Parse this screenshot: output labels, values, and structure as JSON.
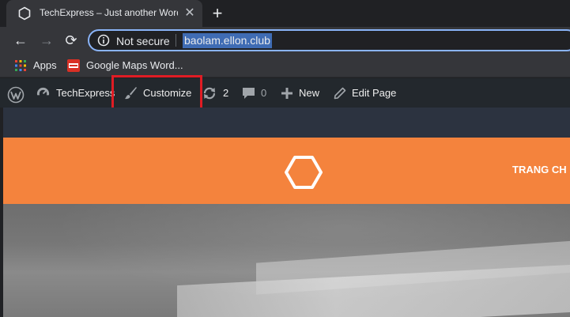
{
  "browser": {
    "tab": {
      "title": "TechExpress – Just another Word",
      "close_glyph": "✕",
      "favicon_icon": "hexagon-icon"
    },
    "new_tab_glyph": "+",
    "nav": {
      "back_glyph": "←",
      "forward_glyph": "→",
      "reload_glyph": "⟳"
    },
    "omnibox": {
      "security_label": "Not secure",
      "url": "baolam.ellon.club"
    },
    "bookmarks": [
      {
        "label": "Apps",
        "icon": "apps-grid-icon"
      },
      {
        "label": "Google Maps Word...",
        "icon": "maps-favicon-icon"
      }
    ]
  },
  "adminbar": {
    "site_name": "TechExpress",
    "customize": "Customize",
    "updates_count": "2",
    "comments_count": "0",
    "new_label": "New",
    "edit_label": "Edit Page"
  },
  "site": {
    "menu_item": "TRANG CH"
  },
  "colors": {
    "accent_orange": "#f4833d",
    "highlight_red": "#e01c24",
    "adminbar_bg": "#23282d",
    "url_selection": "#3f6cb4"
  }
}
